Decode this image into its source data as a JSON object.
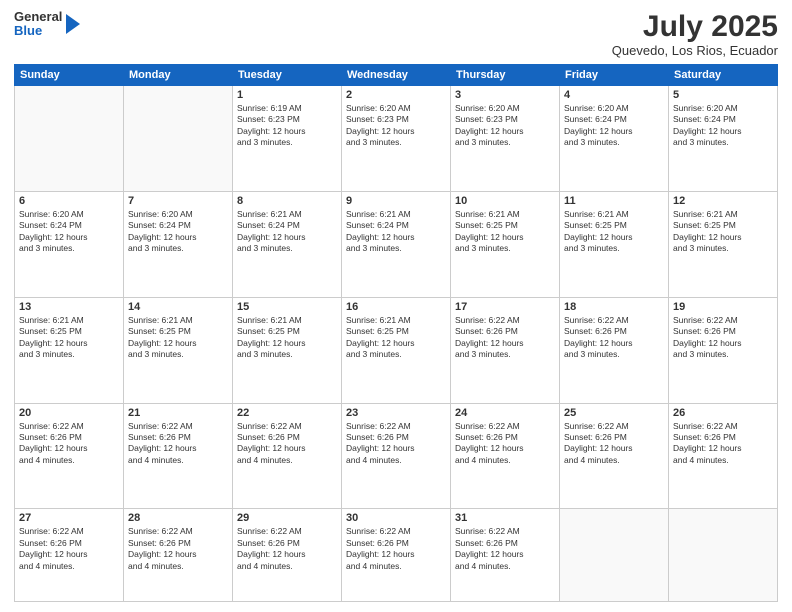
{
  "header": {
    "logo": {
      "line1": "General",
      "line2": "Blue"
    },
    "title": "July 2025",
    "location": "Quevedo, Los Rios, Ecuador"
  },
  "days_of_week": [
    "Sunday",
    "Monday",
    "Tuesday",
    "Wednesday",
    "Thursday",
    "Friday",
    "Saturday"
  ],
  "weeks": [
    [
      {
        "day": "",
        "content": ""
      },
      {
        "day": "",
        "content": ""
      },
      {
        "day": "1",
        "content": "Sunrise: 6:19 AM\nSunset: 6:23 PM\nDaylight: 12 hours\nand 3 minutes."
      },
      {
        "day": "2",
        "content": "Sunrise: 6:20 AM\nSunset: 6:23 PM\nDaylight: 12 hours\nand 3 minutes."
      },
      {
        "day": "3",
        "content": "Sunrise: 6:20 AM\nSunset: 6:23 PM\nDaylight: 12 hours\nand 3 minutes."
      },
      {
        "day": "4",
        "content": "Sunrise: 6:20 AM\nSunset: 6:24 PM\nDaylight: 12 hours\nand 3 minutes."
      },
      {
        "day": "5",
        "content": "Sunrise: 6:20 AM\nSunset: 6:24 PM\nDaylight: 12 hours\nand 3 minutes."
      }
    ],
    [
      {
        "day": "6",
        "content": "Sunrise: 6:20 AM\nSunset: 6:24 PM\nDaylight: 12 hours\nand 3 minutes."
      },
      {
        "day": "7",
        "content": "Sunrise: 6:20 AM\nSunset: 6:24 PM\nDaylight: 12 hours\nand 3 minutes."
      },
      {
        "day": "8",
        "content": "Sunrise: 6:21 AM\nSunset: 6:24 PM\nDaylight: 12 hours\nand 3 minutes."
      },
      {
        "day": "9",
        "content": "Sunrise: 6:21 AM\nSunset: 6:24 PM\nDaylight: 12 hours\nand 3 minutes."
      },
      {
        "day": "10",
        "content": "Sunrise: 6:21 AM\nSunset: 6:25 PM\nDaylight: 12 hours\nand 3 minutes."
      },
      {
        "day": "11",
        "content": "Sunrise: 6:21 AM\nSunset: 6:25 PM\nDaylight: 12 hours\nand 3 minutes."
      },
      {
        "day": "12",
        "content": "Sunrise: 6:21 AM\nSunset: 6:25 PM\nDaylight: 12 hours\nand 3 minutes."
      }
    ],
    [
      {
        "day": "13",
        "content": "Sunrise: 6:21 AM\nSunset: 6:25 PM\nDaylight: 12 hours\nand 3 minutes."
      },
      {
        "day": "14",
        "content": "Sunrise: 6:21 AM\nSunset: 6:25 PM\nDaylight: 12 hours\nand 3 minutes."
      },
      {
        "day": "15",
        "content": "Sunrise: 6:21 AM\nSunset: 6:25 PM\nDaylight: 12 hours\nand 3 minutes."
      },
      {
        "day": "16",
        "content": "Sunrise: 6:21 AM\nSunset: 6:25 PM\nDaylight: 12 hours\nand 3 minutes."
      },
      {
        "day": "17",
        "content": "Sunrise: 6:22 AM\nSunset: 6:26 PM\nDaylight: 12 hours\nand 3 minutes."
      },
      {
        "day": "18",
        "content": "Sunrise: 6:22 AM\nSunset: 6:26 PM\nDaylight: 12 hours\nand 3 minutes."
      },
      {
        "day": "19",
        "content": "Sunrise: 6:22 AM\nSunset: 6:26 PM\nDaylight: 12 hours\nand 3 minutes."
      }
    ],
    [
      {
        "day": "20",
        "content": "Sunrise: 6:22 AM\nSunset: 6:26 PM\nDaylight: 12 hours\nand 4 minutes."
      },
      {
        "day": "21",
        "content": "Sunrise: 6:22 AM\nSunset: 6:26 PM\nDaylight: 12 hours\nand 4 minutes."
      },
      {
        "day": "22",
        "content": "Sunrise: 6:22 AM\nSunset: 6:26 PM\nDaylight: 12 hours\nand 4 minutes."
      },
      {
        "day": "23",
        "content": "Sunrise: 6:22 AM\nSunset: 6:26 PM\nDaylight: 12 hours\nand 4 minutes."
      },
      {
        "day": "24",
        "content": "Sunrise: 6:22 AM\nSunset: 6:26 PM\nDaylight: 12 hours\nand 4 minutes."
      },
      {
        "day": "25",
        "content": "Sunrise: 6:22 AM\nSunset: 6:26 PM\nDaylight: 12 hours\nand 4 minutes."
      },
      {
        "day": "26",
        "content": "Sunrise: 6:22 AM\nSunset: 6:26 PM\nDaylight: 12 hours\nand 4 minutes."
      }
    ],
    [
      {
        "day": "27",
        "content": "Sunrise: 6:22 AM\nSunset: 6:26 PM\nDaylight: 12 hours\nand 4 minutes."
      },
      {
        "day": "28",
        "content": "Sunrise: 6:22 AM\nSunset: 6:26 PM\nDaylight: 12 hours\nand 4 minutes."
      },
      {
        "day": "29",
        "content": "Sunrise: 6:22 AM\nSunset: 6:26 PM\nDaylight: 12 hours\nand 4 minutes."
      },
      {
        "day": "30",
        "content": "Sunrise: 6:22 AM\nSunset: 6:26 PM\nDaylight: 12 hours\nand 4 minutes."
      },
      {
        "day": "31",
        "content": "Sunrise: 6:22 AM\nSunset: 6:26 PM\nDaylight: 12 hours\nand 4 minutes."
      },
      {
        "day": "",
        "content": ""
      },
      {
        "day": "",
        "content": ""
      }
    ]
  ]
}
